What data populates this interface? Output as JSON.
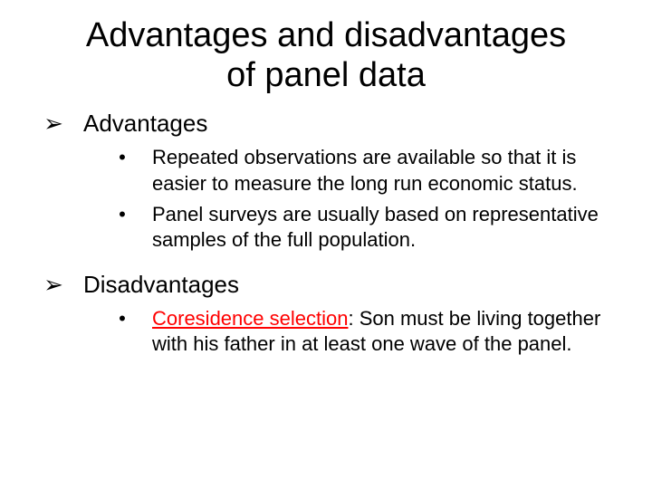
{
  "title_line1": "Advantages and disadvantages",
  "title_line2": "of panel data",
  "sections": {
    "advantages": {
      "heading": "Advantages",
      "items": [
        "Repeated observations are available so that it is easier to measure the long run economic status.",
        "Panel surveys are usually based on representative samples of the full population."
      ]
    },
    "disadvantages": {
      "heading": "Disadvantages",
      "coresidence_label": "Coresidence selection",
      "coresidence_rest": ": Son must be living together with his father in at least one wave of the panel."
    }
  },
  "glyphs": {
    "arrow": "➢",
    "bullet": "•"
  }
}
